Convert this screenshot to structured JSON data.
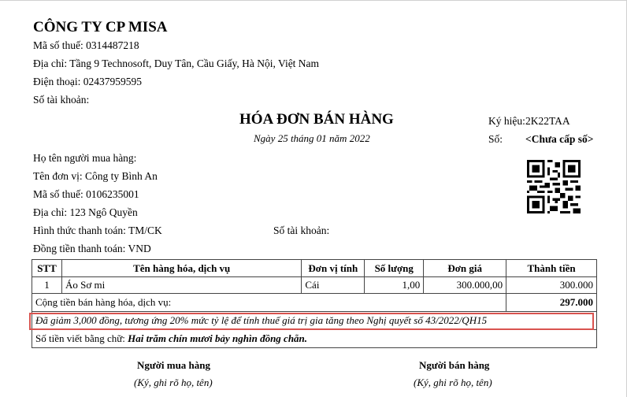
{
  "seller": {
    "name": "CÔNG TY CP MISA",
    "tax_code": "Mã số thuế: 0314487218",
    "address": "Địa chỉ: Tầng 9 Technosoft, Duy Tân, Cầu Giấy, Hà Nội, Việt Nam",
    "phone": "Điện thoại: 02437959595",
    "account": "Số tài khoản:"
  },
  "invoice": {
    "title": "HÓA ĐƠN BÁN HÀNG",
    "date": "Ngày 25 tháng 01 năm 2022",
    "symbol_label": "Ký hiệu:",
    "symbol_value": "2K22TAA",
    "number_label": "Số:",
    "number_value": "<Chưa cấp số>"
  },
  "buyer": {
    "name": "Họ tên người mua hàng:",
    "unit": "Tên đơn vị: Công ty Bình An",
    "tax_code": "Mã số thuế: 0106235001",
    "address": "Địa chỉ: 123 Ngô Quyền",
    "payment": "Hình thức thanh toán: TM/CK",
    "account": "Số tài khoản:",
    "currency": "Đồng tiền thanh toán: VND"
  },
  "table": {
    "headers": [
      "STT",
      "Tên hàng hóa, dịch vụ",
      "Đơn vị tính",
      "Số lượng",
      "Đơn giá",
      "Thành tiền"
    ],
    "rows": [
      {
        "stt": "1",
        "name": "Áo Sơ mi",
        "unit": "Cái",
        "qty": "1,00",
        "price": "300.000,00",
        "amount": "300.000"
      }
    ],
    "subtotal_label": "Cộng tiền bán hàng hóa, dịch vụ:",
    "subtotal_value": "297.000",
    "discount_note": "Đã giảm 3,000 đồng, tương ứng 20% mức tỷ lệ để tính thuế giá trị gia tăng theo Nghị quyết số 43/2022/QH15",
    "words_label": "Số tiền viết bằng chữ:",
    "words_value": "Hai trăm chín mươi bảy nghìn đồng chẵn."
  },
  "signatures": {
    "buyer_title": "Người mua hàng",
    "buyer_note": "(Ký, ghi rõ họ, tên)",
    "seller_title": "Người bán hàng",
    "seller_note": "(Ký, ghi rõ họ, tên)"
  },
  "colors": {
    "highlight_border": "#d9534f"
  }
}
